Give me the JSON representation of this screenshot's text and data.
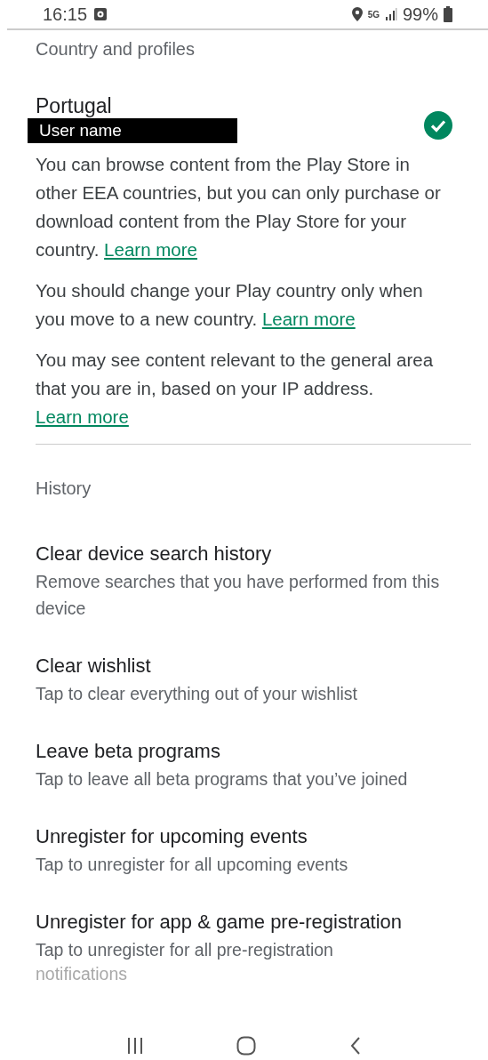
{
  "status_bar": {
    "time": "16:15",
    "network": "5G",
    "battery": "99%"
  },
  "country_section": {
    "label": "Country and profiles",
    "country": "Portugal",
    "user_name": "User name",
    "selected": true,
    "paragraphs": [
      {
        "text": "You can browse content from the Play Store in other EEA countries, but you can only purchase or download content from the Play Store for your country.",
        "link": "Learn more"
      },
      {
        "text": "You should change your Play country only when you move to a new country.",
        "link": "Learn more"
      },
      {
        "text": "You may see content relevant to the general area that you are in, based on your IP address.",
        "link": "Learn more"
      }
    ]
  },
  "history_section": {
    "label": "History",
    "items": [
      {
        "title": "Clear device search history",
        "subtitle": "Remove searches that you have performed from this device"
      },
      {
        "title": "Clear wishlist",
        "subtitle": "Tap to clear everything out of your wishlist"
      },
      {
        "title": "Leave beta programs",
        "subtitle": "Tap to leave all beta programs that you’ve joined"
      },
      {
        "title": "Unregister for upcoming events",
        "subtitle": "Tap to unregister for all upcoming events"
      },
      {
        "title": "Unregister for app & game pre-registration",
        "subtitle": "Tap to unregister for all pre-registration",
        "faded_line": "notifications"
      }
    ]
  }
}
